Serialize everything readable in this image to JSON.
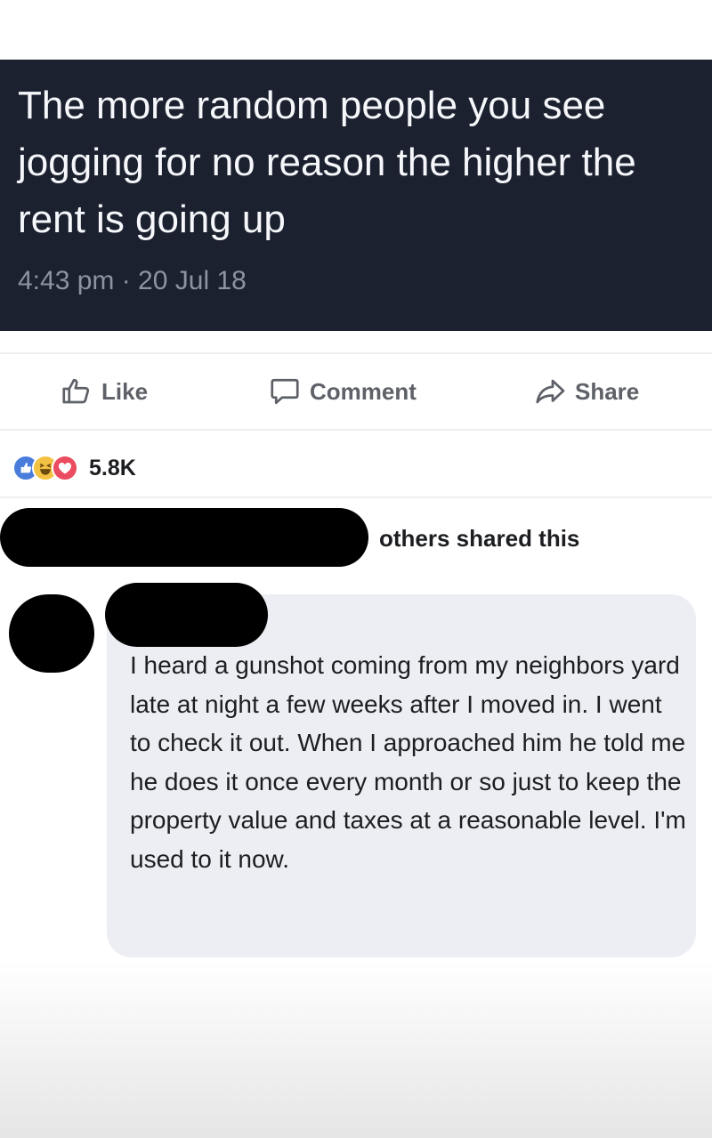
{
  "tweet": {
    "text": "The more random people you see jogging for no reason the higher the rent is going up",
    "timestamp": "4:43 pm · 20 Jul 18"
  },
  "actions": {
    "like_label": "Like",
    "comment_label": "Comment",
    "share_label": "Share"
  },
  "reactions": {
    "types": [
      "like",
      "haha",
      "love"
    ],
    "count": "5.8K"
  },
  "shares": {
    "label": "others shared this"
  },
  "comment": {
    "text": "I heard a gunshot coming from my neighbors yard late at night a few weeks after I moved in. I went to check it out. When I approached him he told me he does it once every month or so just to keep the property value and taxes at a reasonable level. I'm used to it now."
  },
  "colors": {
    "tweet_background": "#1c2130",
    "tweet_text": "#f5f7fa",
    "timestamp_text": "#8c93a1",
    "action_text": "#5e6168",
    "like_reaction": "#4a7ddb",
    "haha_reaction": "#f4c242",
    "love_reaction": "#ec4c5f",
    "comment_bubble": "#eceef3"
  }
}
